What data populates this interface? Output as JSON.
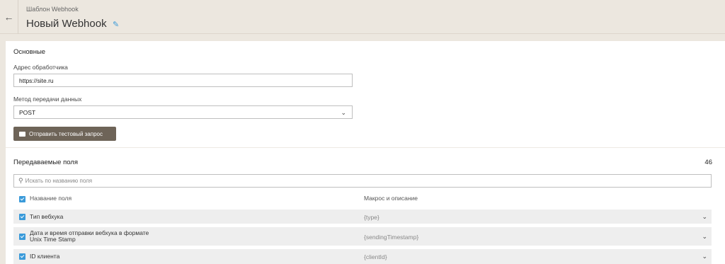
{
  "header": {
    "back_icon": "arrow-left-icon",
    "breadcrumb": "Шаблон Webhook",
    "title": "Новый Webhook",
    "edit_icon": "pencil-icon"
  },
  "basic": {
    "section_title": "Основные",
    "url_label": "Адрес обработчика",
    "url_value": "https://site.ru",
    "method_label": "Метод передачи данных",
    "method_value": "POST",
    "test_button": "Отправить тестовый запрос"
  },
  "fields": {
    "section_title": "Передаваемые поля",
    "count": "46",
    "search_placeholder": "Искать по названию поля",
    "col_name": "Название поля",
    "col_macro": "Макрос и описание",
    "rows": [
      {
        "name": "Тип вебхука",
        "macro": "{type}"
      },
      {
        "name": "Дата и время отправки вебхука в формате Unix Time Stamp",
        "macro": "{sendingTimestamp}"
      },
      {
        "name": "ID клиента",
        "macro": "{clientId}"
      }
    ]
  },
  "colors": {
    "accent": "#3a9ad9",
    "button": "#6e6458",
    "background": "#ece7df"
  }
}
